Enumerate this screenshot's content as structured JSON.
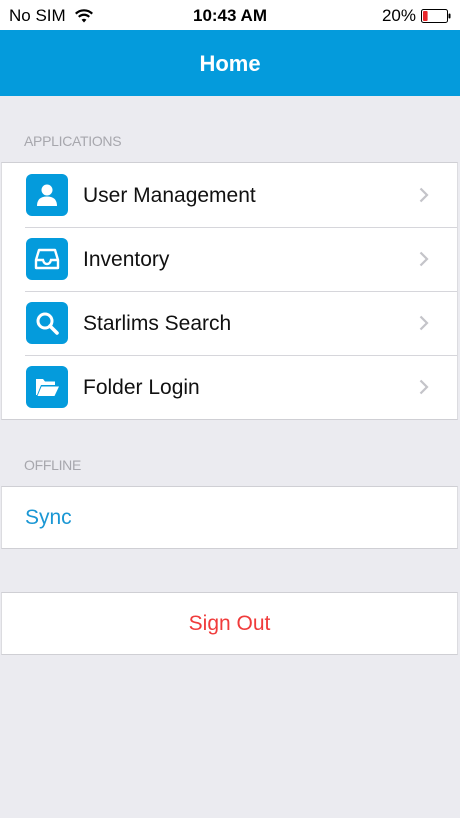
{
  "status_bar": {
    "carrier": "No SIM",
    "time": "10:43 AM",
    "battery_percent": "20%",
    "battery_level": 0.2,
    "battery_color": "#e8262b"
  },
  "nav": {
    "title": "Home",
    "color": "#049bdc"
  },
  "applications": {
    "header": "APPLICATIONS",
    "items": [
      {
        "label": "User Management",
        "icon": "user-icon"
      },
      {
        "label": "Inventory",
        "icon": "inbox-tray-icon"
      },
      {
        "label": "Starlims Search",
        "icon": "search-icon"
      },
      {
        "label": "Folder Login",
        "icon": "folder-open-icon"
      }
    ]
  },
  "offline": {
    "header": "OFFLINE",
    "sync_label": "Sync"
  },
  "sign_out": {
    "label": "Sign Out",
    "color": "#f03b3b"
  }
}
